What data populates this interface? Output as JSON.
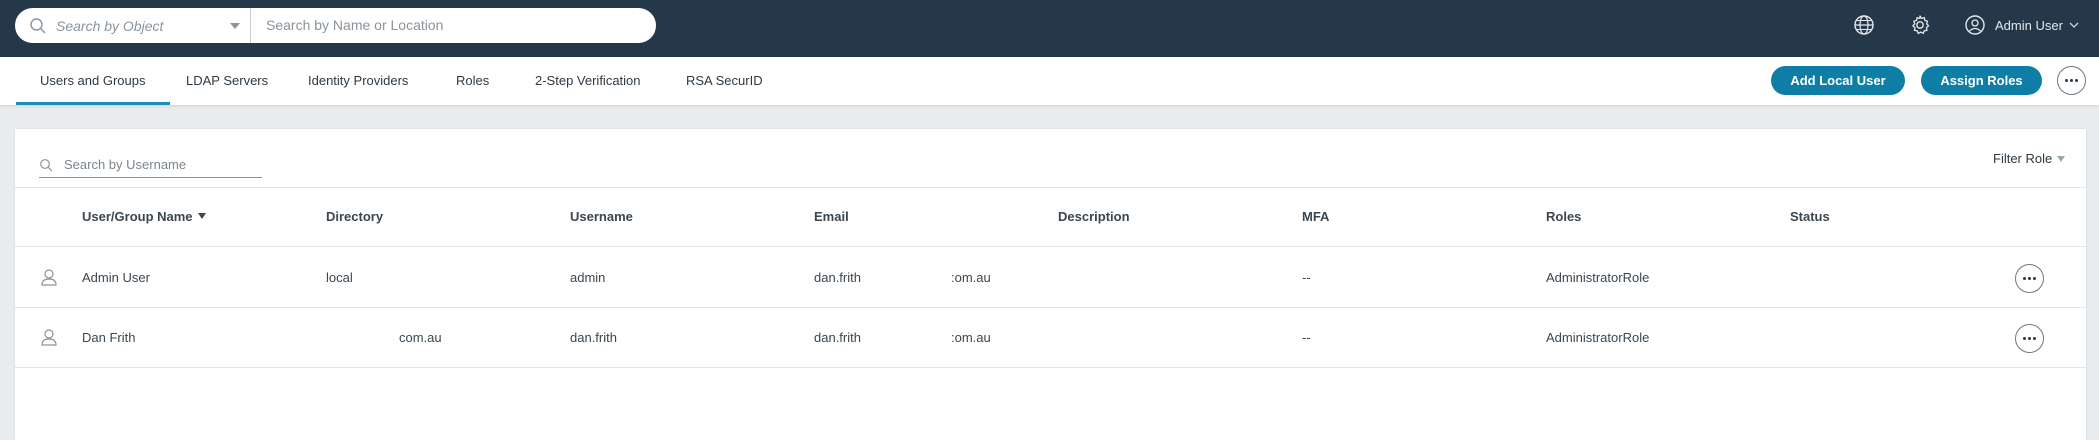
{
  "topbar": {
    "search_object_placeholder": "Search by Object",
    "search_location_placeholder": "Search by Name or Location",
    "user_name": "Admin User"
  },
  "tabs": [
    {
      "label": "Users and Groups",
      "active": true
    },
    {
      "label": "LDAP Servers",
      "active": false
    },
    {
      "label": "Identity Providers",
      "active": false
    },
    {
      "label": "Roles",
      "active": false
    },
    {
      "label": "2-Step Verification",
      "active": false
    },
    {
      "label": "RSA SecurID",
      "active": false
    }
  ],
  "actions": {
    "add_local_user": "Add Local User",
    "assign_roles": "Assign Roles"
  },
  "filter": {
    "username_placeholder": "Search by Username",
    "filter_role_label": "Filter Role"
  },
  "table": {
    "columns": [
      "User/Group Name",
      "Directory",
      "Username",
      "Email",
      "Description",
      "MFA",
      "Roles",
      "Status"
    ],
    "rows": [
      {
        "name": "Admin User",
        "directory": "local",
        "username": "admin",
        "email_user": "dan.frith",
        "email_domain": ":om.au",
        "description": "",
        "mfa": "--",
        "roles": "AdministratorRole",
        "status": ""
      },
      {
        "name": "Dan Frith",
        "directory": "com.au",
        "username": "dan.frith",
        "email_user": "dan.frith",
        "email_domain": ":om.au",
        "description": "",
        "mfa": "--",
        "roles": "AdministratorRole",
        "status": ""
      }
    ]
  },
  "colors": {
    "topbar_bg": "#25384a",
    "accent": "#0e7ea6",
    "tab_underline": "#1e8fb8"
  },
  "icons": [
    "search-icon",
    "caret-down-icon",
    "globe-icon",
    "gear-icon",
    "user-circle-icon",
    "chevron-down-icon",
    "more-icon",
    "user-icon",
    "sort-desc-icon",
    "filter-icon"
  ]
}
